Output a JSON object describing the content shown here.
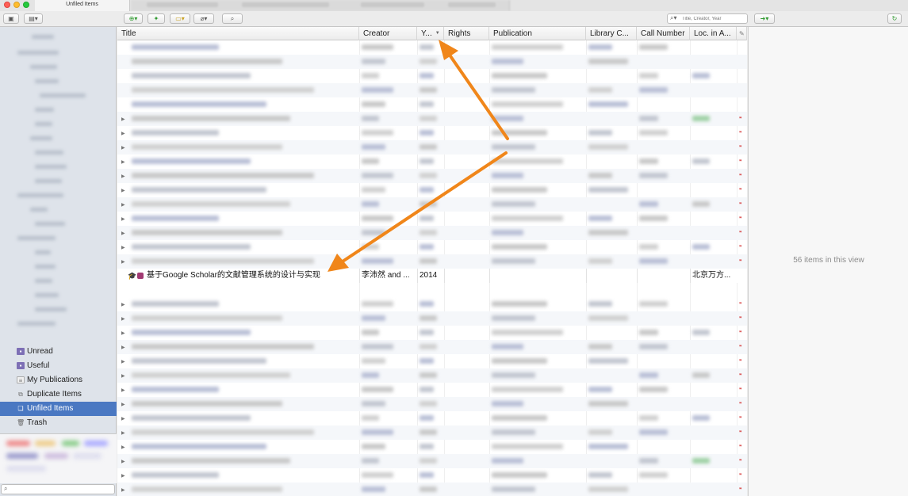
{
  "window": {
    "tab_title": "Unfiled Items"
  },
  "search": {
    "placeholder": "Title, Creator, Year"
  },
  "collections": {
    "items": [
      {
        "label": "Unread",
        "icon": "folder-icon"
      },
      {
        "label": "Useful",
        "icon": "folder-icon"
      },
      {
        "label": "My Publications",
        "icon": "document-icon"
      },
      {
        "label": "Duplicate Items",
        "icon": "duplicate-icon"
      },
      {
        "label": "Unfiled Items",
        "icon": "unfiled-icon",
        "selected": true
      },
      {
        "label": "Trash",
        "icon": "trash-icon"
      }
    ]
  },
  "columns": [
    {
      "key": "title",
      "label": "Title"
    },
    {
      "key": "creator",
      "label": "Creator"
    },
    {
      "key": "year",
      "label": "Y...",
      "sort": "descending"
    },
    {
      "key": "rights",
      "label": "Rights"
    },
    {
      "key": "publication",
      "label": "Publication"
    },
    {
      "key": "library_catalog",
      "label": "Library C..."
    },
    {
      "key": "call_number",
      "label": "Call Number"
    },
    {
      "key": "loc_in_archive",
      "label": "Loc. in A..."
    }
  ],
  "highlighted_item": {
    "title": "基于Google Scholar的文献管理系统的设计与实现",
    "creator": "李沛然 and ...",
    "year": "2014",
    "rights": "",
    "publication": "",
    "library_catalog": "",
    "call_number": "",
    "loc_in_archive": "北京万方..."
  },
  "item_pane": {
    "message": "56 items in this view"
  },
  "colors": {
    "annotation_arrow": "#f0861a",
    "selection": "#4a78c2"
  }
}
